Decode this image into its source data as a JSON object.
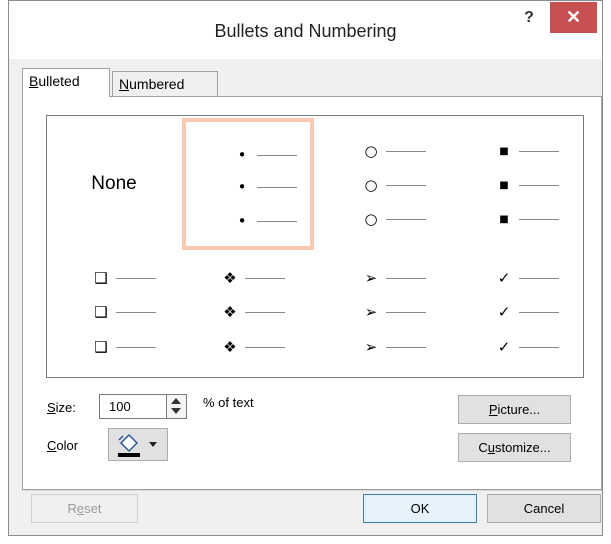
{
  "window": {
    "title": "Bullets and Numbering",
    "help_label": "?",
    "close_label": "✕"
  },
  "tabs": [
    {
      "label": "Bulleted",
      "hotkey": "B",
      "rest": "ulleted"
    },
    {
      "label": "Numbered",
      "hotkey": "N",
      "rest": "umbered"
    }
  ],
  "gallery": {
    "none_label": "None",
    "selected": "round-bullet",
    "styles": [
      {
        "name": "round-bullet",
        "glyph": "•"
      },
      {
        "name": "hollow-round-bullet",
        "glyph": "○"
      },
      {
        "name": "square-bullet",
        "glyph": "■"
      },
      {
        "name": "hollow-square-bullet",
        "glyph": "❑"
      },
      {
        "name": "star-bullet",
        "glyph": "❖"
      },
      {
        "name": "arrow-bullet",
        "glyph": "➢"
      },
      {
        "name": "checkmark-bullet",
        "glyph": "✓"
      }
    ]
  },
  "size": {
    "label": "Size:",
    "hotkey": "S",
    "rest": "ize:",
    "value": "100",
    "unit_label": "% of text"
  },
  "color": {
    "label": "Color",
    "hotkey": "C",
    "rest": "olor",
    "swatch": "#000000"
  },
  "buttons": {
    "picture": {
      "label": "Picture...",
      "hotkey": "P",
      "rest": "icture..."
    },
    "customize": {
      "label": "Customize...",
      "pre": "C",
      "hotkey": "u",
      "rest": "stomize..."
    },
    "reset": {
      "label": "Reset",
      "pre": "R",
      "hotkey": "e",
      "rest": "set"
    },
    "ok": {
      "label": "OK"
    },
    "cancel": {
      "label": "Cancel"
    }
  },
  "colors": {
    "close_button": "#c75050",
    "selection_border": "#f9c9b1",
    "ok_border": "#3c7fb1"
  }
}
